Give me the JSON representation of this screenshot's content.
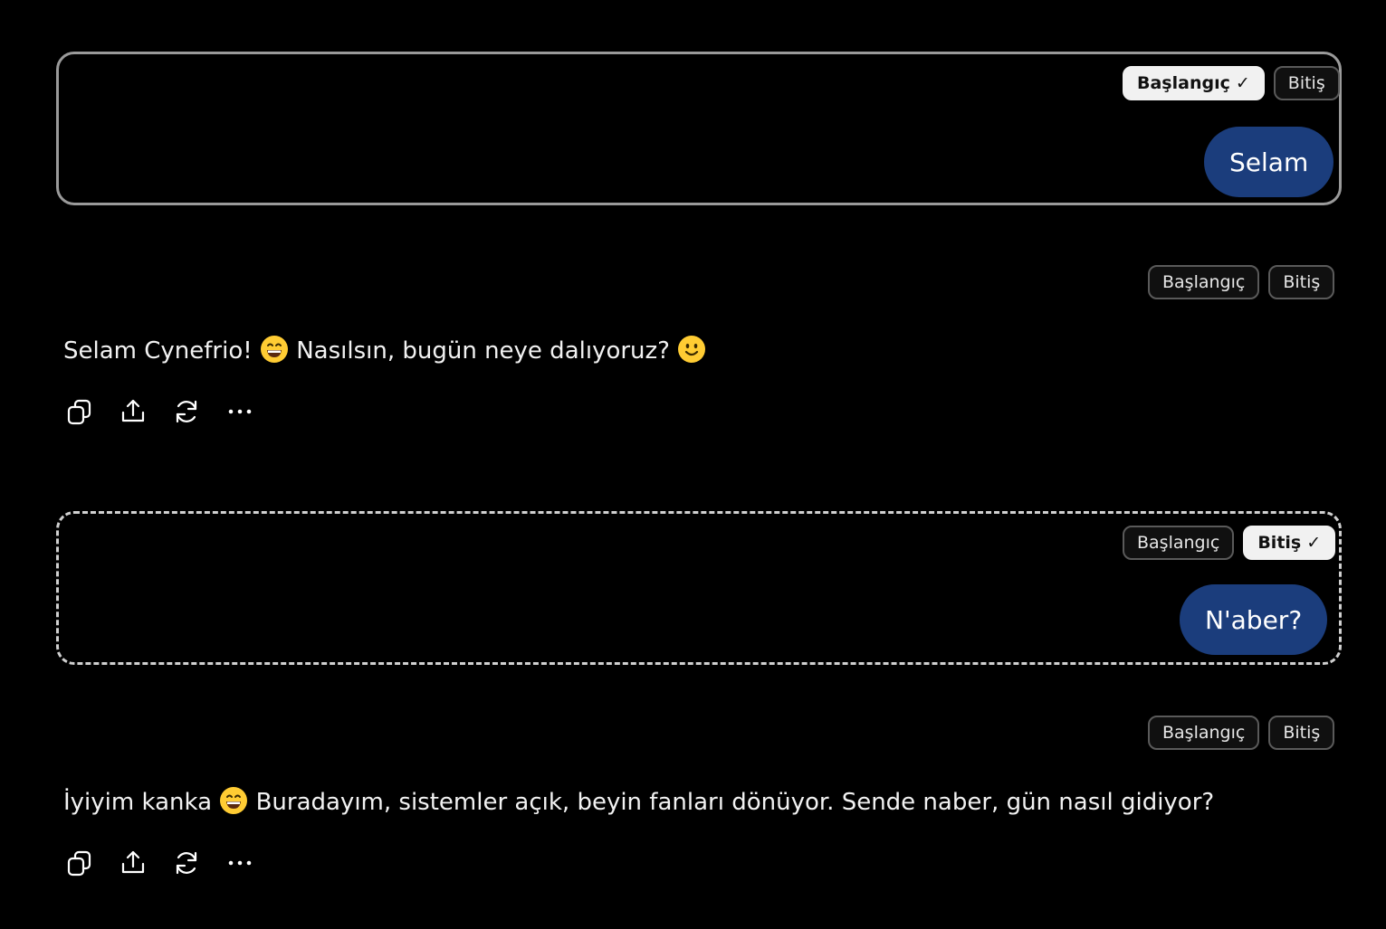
{
  "turns": [
    {
      "user_message": "Selam",
      "toggle": {
        "start_label": "Başlangıç",
        "end_label": "Bitiş",
        "start_active": true,
        "end_active": false,
        "check": "✓"
      }
    },
    {
      "assistant_toggle": {
        "start_label": "Başlangıç",
        "end_label": "Bitiş"
      },
      "reply": {
        "part1": "Selam Cynefrio!",
        "emoji1": "grinning-face",
        "part2": "Nasılsın, bugün neye dalıyoruz?",
        "emoji2": "slightly-smiling-face"
      }
    },
    {
      "user_message": "N'aber?",
      "toggle": {
        "start_label": "Başlangıç",
        "end_label": "Bitiş",
        "start_active": false,
        "end_active": true,
        "check": "✓"
      }
    },
    {
      "assistant_toggle": {
        "start_label": "Başlangıç",
        "end_label": "Bitiş"
      },
      "reply": {
        "part1": "İyiyim kanka",
        "emoji1": "grinning-face",
        "part2": "Buradayım, sistemler açık, beyin fanları dönüyor. Sende naber, gün nasıl gidiyor?"
      }
    }
  ],
  "actions": [
    "copy-icon",
    "share-icon",
    "regenerate-icon",
    "more-icon"
  ],
  "colors": {
    "background": "#000000",
    "user_bubble": "#1b3d7c",
    "active_pill": "#f1f1f1",
    "emoji_yellow": "#ffcc33"
  }
}
